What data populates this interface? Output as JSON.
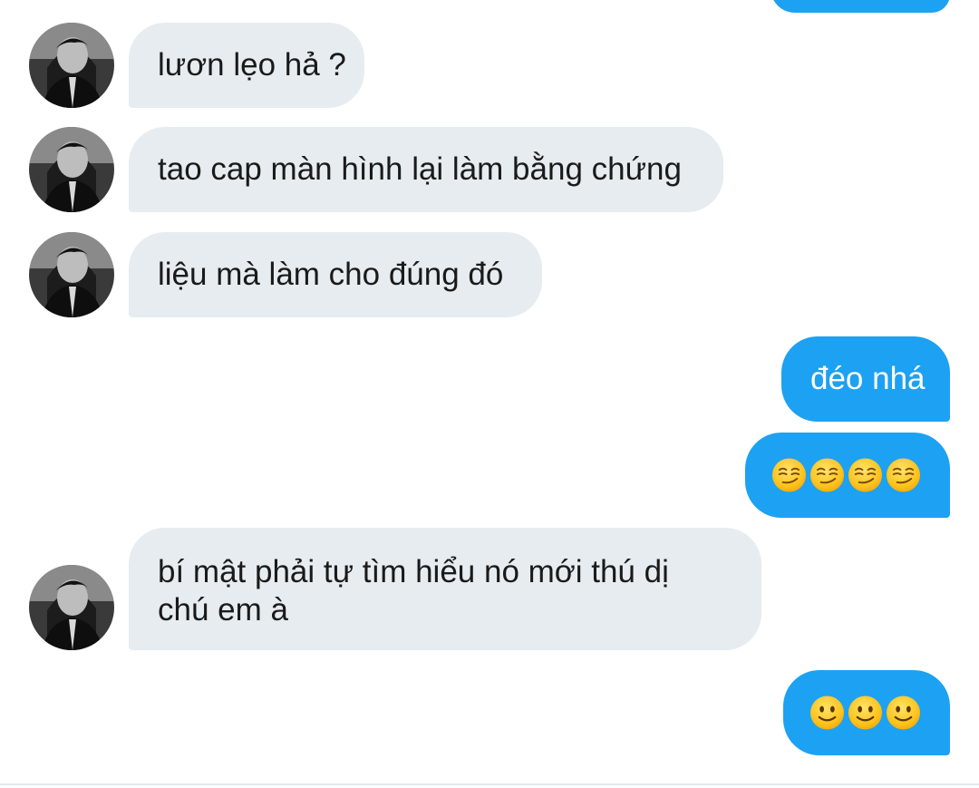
{
  "messages": [
    {
      "side": "outgoing",
      "text": ""
    },
    {
      "side": "incoming",
      "text": "lươn lẹo hả ?"
    },
    {
      "side": "incoming",
      "text": "tao cap màn hình lại làm bằng chứng"
    },
    {
      "side": "incoming",
      "text": "liệu mà làm cho đúng đó"
    },
    {
      "side": "outgoing",
      "text": "đéo nhá"
    },
    {
      "side": "outgoing",
      "emoji": "smirking-face",
      "count": 4
    },
    {
      "side": "incoming",
      "text_line1": "bí mật phải tự tìm hiểu nó mới thú dị",
      "text_line2": "chú em à"
    },
    {
      "side": "outgoing",
      "emoji": "slightly-smiling-face",
      "count": 3
    }
  ],
  "colors": {
    "incoming_bubble": "#e6ecf0",
    "outgoing_bubble": "#1da1f2",
    "incoming_text": "#1a1a1a",
    "outgoing_text": "#ffffff",
    "divider": "#e1e8ed"
  },
  "avatar": {
    "icon": "user-avatar-photo"
  }
}
